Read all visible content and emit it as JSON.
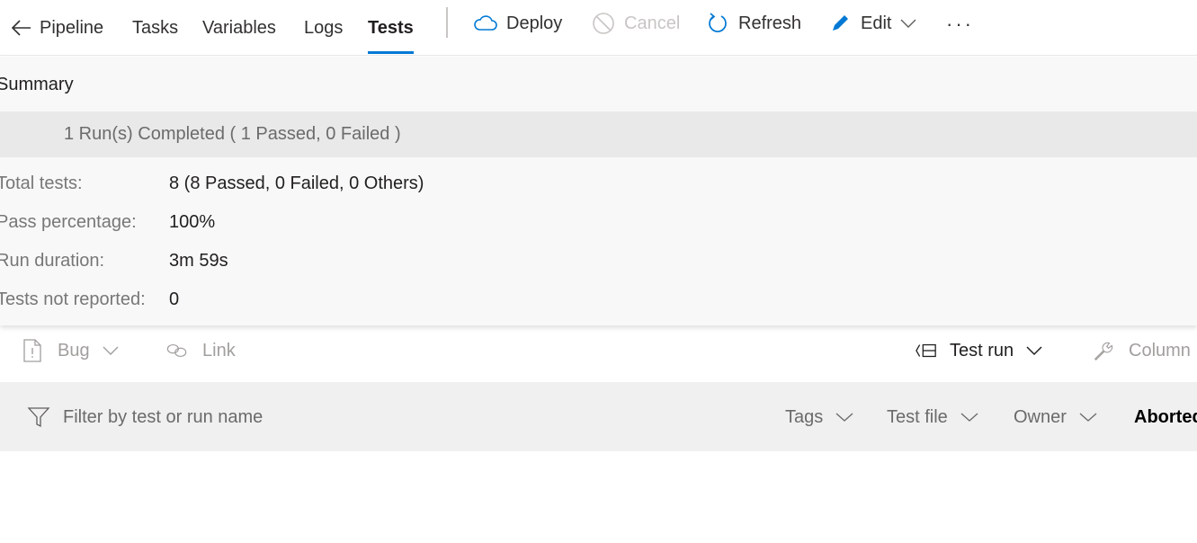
{
  "nav": {
    "back_label": "Pipeline",
    "tabs": [
      {
        "label": "Tasks",
        "active": false
      },
      {
        "label": "Variables",
        "active": false
      },
      {
        "label": "Logs",
        "active": false
      },
      {
        "label": "Tests",
        "active": true
      }
    ]
  },
  "commands": {
    "deploy": {
      "label": "Deploy",
      "icon": "cloud-icon",
      "enabled": true
    },
    "cancel": {
      "label": "Cancel",
      "icon": "cancel-icon",
      "enabled": false
    },
    "refresh": {
      "label": "Refresh",
      "icon": "refresh-icon",
      "enabled": true
    },
    "edit": {
      "label": "Edit",
      "icon": "pencil-icon",
      "enabled": true
    },
    "more": "···"
  },
  "summary": {
    "title": "Summary",
    "runs_text": "1 Run(s) Completed ( 1 Passed, 0 Failed )",
    "stats": [
      {
        "label": "Total tests:",
        "value": "8 (8 Passed, 0 Failed, 0 Others)"
      },
      {
        "label": "Pass percentage:",
        "value": "100%"
      },
      {
        "label": "Run duration:",
        "value": "3m 59s"
      },
      {
        "label": "Tests not reported:",
        "value": "0"
      }
    ]
  },
  "toolbar": {
    "bug_label": "Bug",
    "link_label": "Link",
    "group_by_label": "Test run",
    "column_label": "Column"
  },
  "filters": {
    "search_placeholder": "Filter by test or run name",
    "search_value": "",
    "dropdowns": [
      "Tags",
      "Test file",
      "Owner"
    ],
    "outcome_label": "Aborted"
  },
  "colors": {
    "accent": "#0078d4",
    "summary_bg": "#f8f8f8",
    "runs_band_bg": "#e9e9e9",
    "filter_bg": "#f0f0f0"
  }
}
